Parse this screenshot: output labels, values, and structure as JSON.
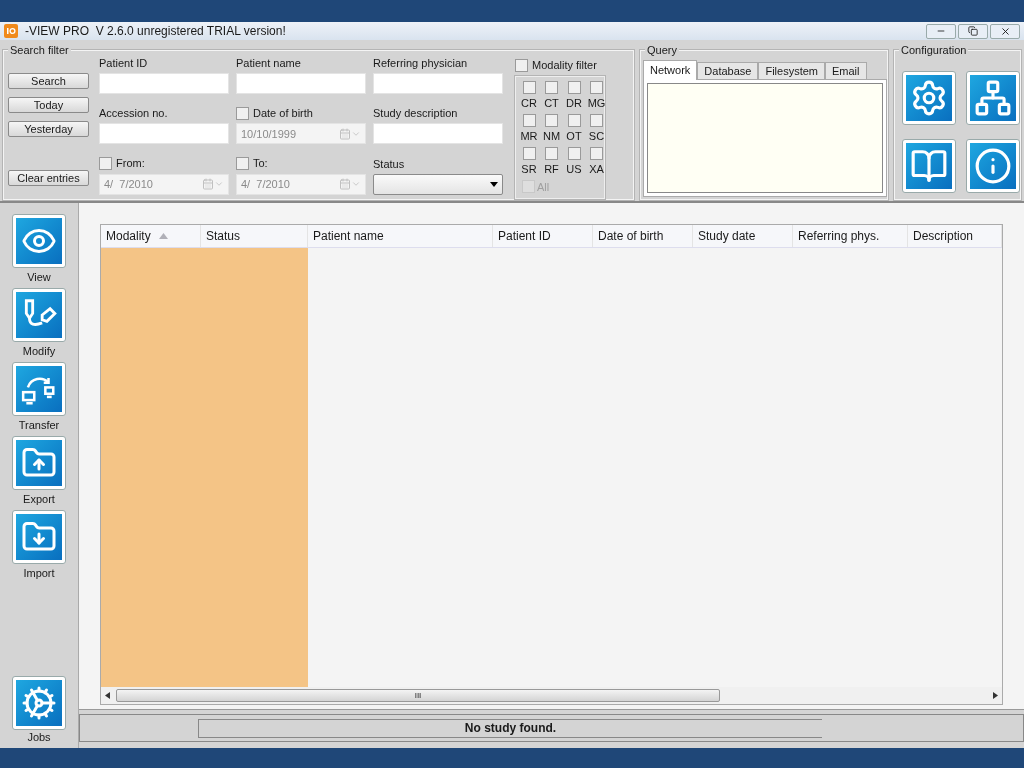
{
  "window": {
    "title": "-VIEW PRO  V 2.6.0 unregistered TRIAL version!"
  },
  "search_filter": {
    "title": "Search filter",
    "buttons": [
      "Search",
      "Today",
      "Yesterday",
      "Clear entries"
    ],
    "fields": [
      {
        "kind": "text",
        "label": "Patient ID"
      },
      {
        "kind": "text",
        "label": "Patient name"
      },
      {
        "kind": "text",
        "label": "Referring physician"
      },
      {
        "kind": "text",
        "label": "Accession no."
      },
      {
        "kind": "date",
        "label": "Date of birth",
        "checked": false,
        "value": "10/10/1999"
      },
      {
        "kind": "text",
        "label": "Study description"
      },
      {
        "kind": "date",
        "label": "From:",
        "checked": false,
        "value": "4/  7/2010"
      },
      {
        "kind": "date",
        "label": "To:",
        "checked": false,
        "value": "4/  7/2010"
      },
      {
        "kind": "select",
        "label": "Status"
      }
    ]
  },
  "modality_filter": {
    "label": "Modality filter",
    "checked": false,
    "items": [
      {
        "label": "CR",
        "checked": false
      },
      {
        "label": "CT",
        "checked": false
      },
      {
        "label": "DR",
        "checked": false
      },
      {
        "label": "MG",
        "checked": false
      },
      {
        "label": "MR",
        "checked": false
      },
      {
        "label": "NM",
        "checked": false
      },
      {
        "label": "OT",
        "checked": false
      },
      {
        "label": "SC",
        "checked": false
      },
      {
        "label": "SR",
        "checked": false
      },
      {
        "label": "RF",
        "checked": false
      },
      {
        "label": "US",
        "checked": false
      },
      {
        "label": "XA",
        "checked": false
      }
    ],
    "all": {
      "label": "All",
      "checked": false,
      "disabled": true
    }
  },
  "query": {
    "title": "Query",
    "tabs": [
      {
        "label": "Network",
        "selected": true
      },
      {
        "label": "Database",
        "selected": false
      },
      {
        "label": "Filesystem",
        "selected": false
      },
      {
        "label": "Email",
        "selected": false
      }
    ]
  },
  "configuration": {
    "title": "Configuration",
    "buttons": [
      {
        "kind": "settings"
      },
      {
        "kind": "network"
      },
      {
        "kind": "manual"
      },
      {
        "kind": "info"
      }
    ]
  },
  "sidebar": {
    "items": [
      {
        "kind": "view",
        "label": "View"
      },
      {
        "kind": "modify",
        "label": "Modify"
      },
      {
        "kind": "transfer",
        "label": "Transfer"
      },
      {
        "kind": "export",
        "label": "Export"
      },
      {
        "kind": "import",
        "label": "Import"
      }
    ],
    "jobs": {
      "kind": "jobs",
      "label": "Jobs"
    }
  },
  "table": {
    "columns": [
      {
        "label": "Modality",
        "sorted": true,
        "highlighted": true
      },
      {
        "label": "Status",
        "sorted": false,
        "highlighted": true
      },
      {
        "label": "Patient name",
        "sorted": false,
        "highlighted": false
      },
      {
        "label": "Patient ID",
        "sorted": false,
        "highlighted": false
      },
      {
        "label": "Date of birth",
        "sorted": false,
        "highlighted": false
      },
      {
        "label": "Study date",
        "sorted": false,
        "highlighted": false
      },
      {
        "label": "Referring phys.",
        "sorted": false,
        "highlighted": false
      },
      {
        "label": "Description",
        "sorted": false,
        "highlighted": false
      }
    ],
    "scroll_grip": "III"
  },
  "status_bar": {
    "message": "No study found."
  }
}
